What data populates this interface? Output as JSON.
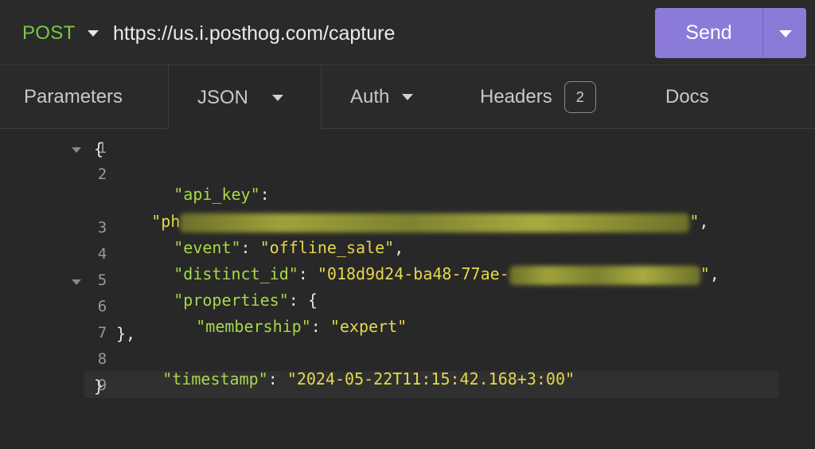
{
  "request": {
    "method": "POST",
    "url": "https://us.i.posthog.com/capture",
    "send_label": "Send"
  },
  "tabs": [
    {
      "label": "Parameters"
    },
    {
      "label": "JSON"
    },
    {
      "label": "Auth"
    },
    {
      "label": "Headers",
      "badge": "2"
    },
    {
      "label": "Docs"
    }
  ],
  "editor": {
    "lines": [
      {
        "num": "1",
        "text": "{"
      },
      {
        "num": "2",
        "key": "\"api_key\"",
        "sep": ":"
      },
      {
        "num": "",
        "value_prefix": "\"ph",
        "value_suffix": "\"",
        "trail": ","
      },
      {
        "num": "3",
        "key": "\"event\"",
        "sep": ": ",
        "value": "\"offline_sale\"",
        "trail": ","
      },
      {
        "num": "4",
        "key": "\"distinct_id\"",
        "sep": ": ",
        "value_prefix": "\"018d9d24-ba48-77ae-",
        "value_suffix": "\"",
        "trail": ","
      },
      {
        "num": "5",
        "key": "\"properties\"",
        "sep": ": {"
      },
      {
        "num": "6",
        "key": "\"membership\"",
        "sep": ": ",
        "value": "\"expert\""
      },
      {
        "num": "7",
        "text": "},"
      },
      {
        "num": "8",
        "key": "\"timestamp\"",
        "sep": ": ",
        "value": "\"2024-05-22T11:15:42.168+3:00\""
      },
      {
        "num": "9",
        "text": "}"
      }
    ]
  },
  "colors": {
    "method": "#7ac943",
    "send_button": "#8c7ad8",
    "json_key": "#a6d84a",
    "json_string": "#e5d84a"
  }
}
